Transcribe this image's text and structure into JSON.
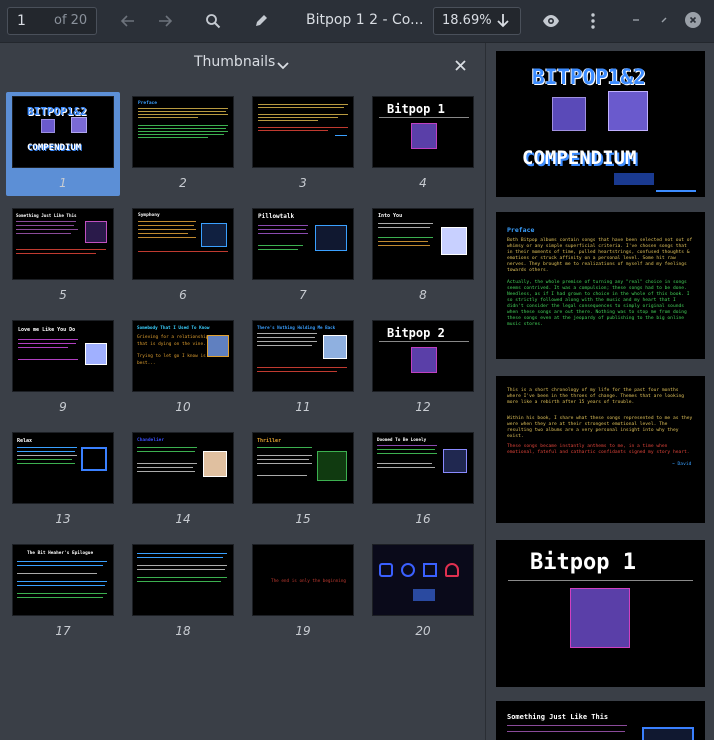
{
  "toolbar": {
    "current_page": "1",
    "page_count_label": "of 20",
    "title": "Bitpop 1  2 - Co...",
    "zoom": "18.69%"
  },
  "thumbnails_panel": {
    "title": "Thumbnails",
    "pages": [
      {
        "num": "1",
        "heading": "BITPOP1&2",
        "selected": true
      },
      {
        "num": "2",
        "heading": "Preface"
      },
      {
        "num": "3",
        "heading": ""
      },
      {
        "num": "4",
        "heading": "Bitpop 1"
      },
      {
        "num": "5",
        "heading": "Something Just Like This"
      },
      {
        "num": "6",
        "heading": "Symphony"
      },
      {
        "num": "7",
        "heading": "Pillowtalk"
      },
      {
        "num": "8",
        "heading": "Into You"
      },
      {
        "num": "9",
        "heading": "Love me Like You Do"
      },
      {
        "num": "10",
        "heading": "Somebody That I Used To Know"
      },
      {
        "num": "11",
        "heading": "There's Nothing Holding Me Back"
      },
      {
        "num": "12",
        "heading": "Bitpop 2"
      },
      {
        "num": "13",
        "heading": "Relax"
      },
      {
        "num": "14",
        "heading": "Chandelier"
      },
      {
        "num": "15",
        "heading": "Thriller"
      },
      {
        "num": "16",
        "heading": "Doomed To Be Lonely"
      },
      {
        "num": "17",
        "heading": "The Bit Heaher's Epilogue"
      },
      {
        "num": "18",
        "heading": ""
      },
      {
        "num": "19",
        "heading": ""
      },
      {
        "num": "20",
        "heading": ""
      }
    ],
    "thumb10_lines": [
      "Grieving for a relationship",
      "that is dying on the vine.",
      "Trying to let go I know is",
      "best..."
    ],
    "thumb19_line": "The end is only the beginning"
  },
  "preview": {
    "cover": {
      "line1": "BITPOP1&2",
      "line2": "COMPENDIUM"
    },
    "preface": {
      "title": "Preface",
      "para1": "Both Bitpop albums contain songs that have been selected not out of whimsy or any simple superficial criteria. I've chosen songs that in their moments of time, pulled heartstrings, confused thoughts & emotions or struck affinity on a personal level. Some hit raw nerves. They brought me to realizations of myself and my feelings towards others.",
      "para2": "Actually, the whole premise of turning any \"real\" choice in songs seems contrived. It was a compulsion; these songs had to be done. Needless, as if I had grown to choice in the whole of this book. I so strictly followed along with the music and my heart that I didn't consider the legal consequences to simply original sounds when these songs are out there. Nothing was to stop me from doing these songs even at the jeopardy of publishing to the big online music stores."
    },
    "page3": {
      "para1": "This is a short chronology of my life for the past four months where I've been in the throes of change. Themes that are looking more like a rebirth after 15 years of trouble.",
      "para2": "Within his book, I share what these songs represented to me as they were when they are at their strongest emotional level. The resulting two albums are a very personal insight into why they exist.",
      "para3": "These songs became instantly anthems to me, in a time when emotional, fateful and cathartic confidants signed my story heart.",
      "signature": "~ David"
    },
    "page4": {
      "title": "Bitpop 1"
    },
    "page5": {
      "title": "Something Just Like This"
    }
  },
  "colors": {
    "toolbar_bg": "#2b3038",
    "panel_bg": "#3a3f47",
    "selection": "#5c8fd6",
    "preface_title": "#3aa0ff",
    "preface_text": "#e0c25a",
    "preface_green": "#44d45a",
    "red_text": "#e0443a"
  },
  "icons": [
    "back-arrow-icon",
    "forward-arrow-icon",
    "search-icon",
    "pencil-icon",
    "download-arrow-icon",
    "eye-icon",
    "kebab-menu-icon",
    "minimize-icon",
    "restore-icon",
    "close-icon",
    "chevron-down-icon"
  ]
}
